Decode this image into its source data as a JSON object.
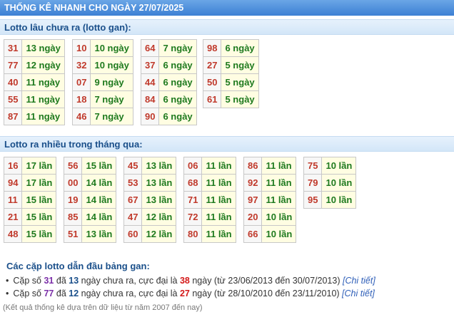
{
  "title": "THỐNG KÊ NHANH CHO NGÀY 27/07/2025",
  "gan_section": {
    "header": "Lotto lâu chưa ra (lotto gan):",
    "groups": [
      [
        {
          "num": "31",
          "count": "13 ngày"
        },
        {
          "num": "77",
          "count": "12 ngày"
        },
        {
          "num": "40",
          "count": "11 ngày"
        },
        {
          "num": "55",
          "count": "11 ngày"
        },
        {
          "num": "87",
          "count": "11 ngày"
        }
      ],
      [
        {
          "num": "10",
          "count": "10 ngày"
        },
        {
          "num": "32",
          "count": "10 ngày"
        },
        {
          "num": "07",
          "count": "9 ngày"
        },
        {
          "num": "18",
          "count": "7 ngày"
        },
        {
          "num": "46",
          "count": "7 ngày"
        }
      ],
      [
        {
          "num": "64",
          "count": "7 ngày"
        },
        {
          "num": "37",
          "count": "6 ngày"
        },
        {
          "num": "44",
          "count": "6 ngày"
        },
        {
          "num": "84",
          "count": "6 ngày"
        },
        {
          "num": "90",
          "count": "6 ngày"
        }
      ],
      [
        {
          "num": "98",
          "count": "6 ngày"
        },
        {
          "num": "27",
          "count": "5 ngày"
        },
        {
          "num": "50",
          "count": "5 ngày"
        },
        {
          "num": "61",
          "count": "5 ngày"
        }
      ]
    ]
  },
  "frequent_section": {
    "header": "Lotto ra nhiều trong tháng qua:",
    "groups": [
      [
        {
          "num": "16",
          "count": "17 lần"
        },
        {
          "num": "94",
          "count": "17 lần"
        },
        {
          "num": "11",
          "count": "15 lần"
        },
        {
          "num": "21",
          "count": "15 lần"
        },
        {
          "num": "48",
          "count": "15 lần"
        }
      ],
      [
        {
          "num": "56",
          "count": "15 lần"
        },
        {
          "num": "00",
          "count": "14 lần"
        },
        {
          "num": "19",
          "count": "14 lần"
        },
        {
          "num": "85",
          "count": "14 lần"
        },
        {
          "num": "51",
          "count": "13 lần"
        }
      ],
      [
        {
          "num": "45",
          "count": "13 lần"
        },
        {
          "num": "53",
          "count": "13 lần"
        },
        {
          "num": "67",
          "count": "13 lần"
        },
        {
          "num": "47",
          "count": "12 lần"
        },
        {
          "num": "60",
          "count": "12 lần"
        }
      ],
      [
        {
          "num": "06",
          "count": "11 lần"
        },
        {
          "num": "68",
          "count": "11 lần"
        },
        {
          "num": "71",
          "count": "11 lần"
        },
        {
          "num": "72",
          "count": "11 lần"
        },
        {
          "num": "80",
          "count": "11 lần"
        }
      ],
      [
        {
          "num": "86",
          "count": "11 lần"
        },
        {
          "num": "92",
          "count": "11 lần"
        },
        {
          "num": "97",
          "count": "11 lần"
        },
        {
          "num": "20",
          "count": "10 lần"
        },
        {
          "num": "66",
          "count": "10 lần"
        }
      ],
      [
        {
          "num": "75",
          "count": "10 lần"
        },
        {
          "num": "79",
          "count": "10 lần"
        },
        {
          "num": "95",
          "count": "10 lần"
        }
      ]
    ]
  },
  "pairs": {
    "title": "Các cặp lotto dẫn đầu bảng gan:",
    "items": [
      {
        "t1": "Cặp số ",
        "num": "31",
        "t2": " đã ",
        "days": "13",
        "t3": " ngày chưa ra, cực đại là ",
        "max": "38",
        "t4": " ngày (từ 23/06/2013 đến 30/07/2013) ",
        "link": "[Chi tiết]"
      },
      {
        "t1": "Cặp số ",
        "num": "77",
        "t2": " đã ",
        "days": "12",
        "t3": " ngày chưa ra, cực đại là ",
        "max": "27",
        "t4": " ngày (từ 28/10/2010 đến 23/11/2010) ",
        "link": "[Chi tiết]"
      }
    ]
  },
  "footnote": "(Kết quả thống kê dựa trên dữ liệu từ năm 2007 đến nay)"
}
